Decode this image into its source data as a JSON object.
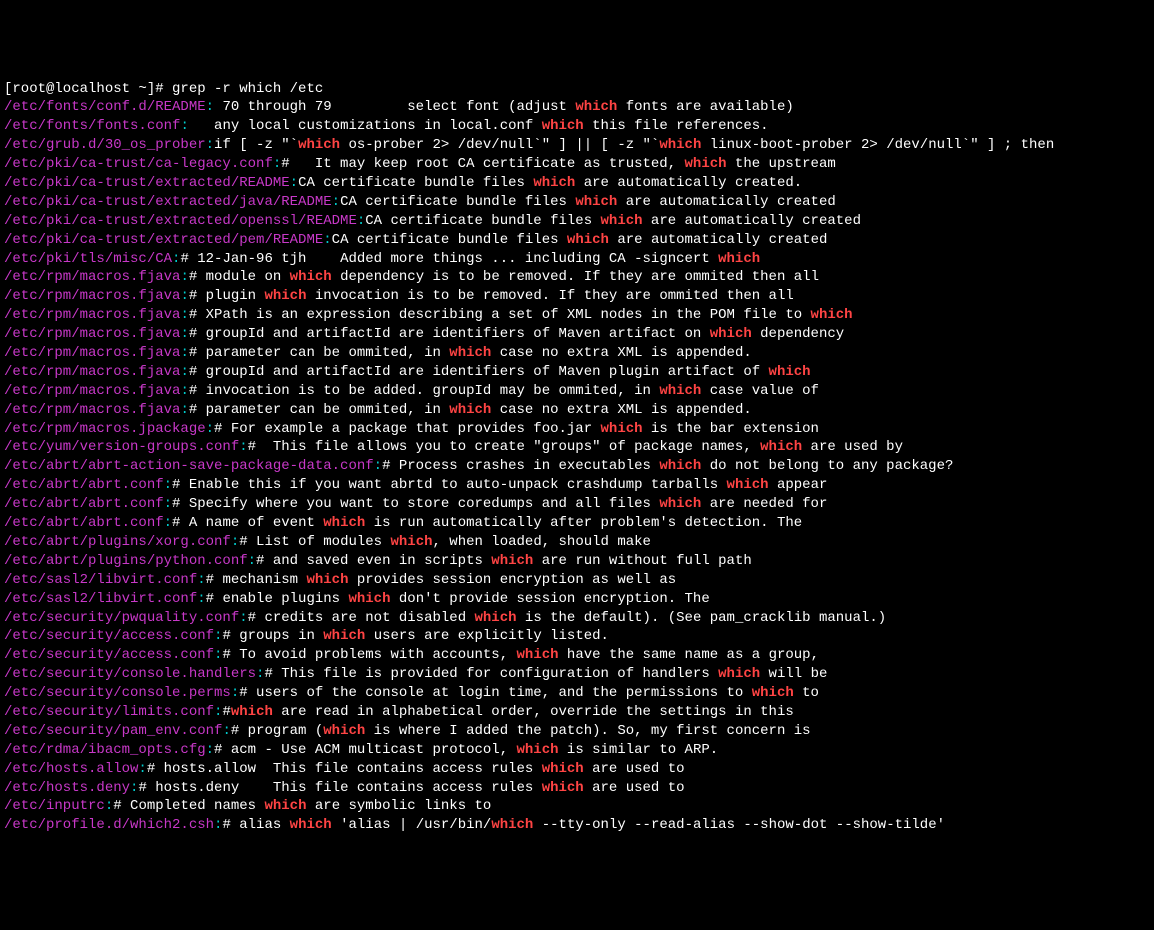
{
  "prompt": "[root@localhost ~]# grep -r which /etc",
  "lines": [
    {
      "path": "/etc/fonts/conf.d/README",
      "parts": [
        ": 70 through 79         select font (adjust ",
        "which",
        " fonts are available)"
      ]
    },
    {
      "path": "/etc/fonts/fonts.conf",
      "parts": [
        ":   any local customizations in local.conf ",
        "which",
        " this file references."
      ]
    },
    {
      "path": "/etc/grub.d/30_os_prober",
      "parts": [
        ":if [ -z \"`",
        "which",
        " os-prober 2> /dev/null`\" ] || [ -z \"`",
        "which",
        " linux-boot-prober 2> /dev/null`\" ] ; then"
      ]
    },
    {
      "path": "/etc/pki/ca-trust/ca-legacy.conf",
      "parts": [
        ":#   It may keep root CA certificate as trusted, ",
        "which",
        " the upstream"
      ]
    },
    {
      "path": "/etc/pki/ca-trust/extracted/README",
      "parts": [
        ":CA certificate bundle files ",
        "which",
        " are automatically created."
      ]
    },
    {
      "path": "/etc/pki/ca-trust/extracted/java/README",
      "parts": [
        ":CA certificate bundle files ",
        "which",
        " are automatically created"
      ]
    },
    {
      "path": "/etc/pki/ca-trust/extracted/openssl/README",
      "parts": [
        ":CA certificate bundle files ",
        "which",
        " are automatically created"
      ]
    },
    {
      "path": "/etc/pki/ca-trust/extracted/pem/README",
      "parts": [
        ":CA certificate bundle files ",
        "which",
        " are automatically created"
      ]
    },
    {
      "path": "/etc/pki/tls/misc/CA",
      "parts": [
        ":# 12-Jan-96 tjh    Added more things ... including CA -signcert ",
        "which"
      ]
    },
    {
      "path": "/etc/rpm/macros.fjava",
      "parts": [
        ":# module on ",
        "which",
        " dependency is to be removed. If they are ommited then all"
      ]
    },
    {
      "path": "/etc/rpm/macros.fjava",
      "parts": [
        ":# plugin ",
        "which",
        " invocation is to be removed. If they are ommited then all"
      ]
    },
    {
      "path": "/etc/rpm/macros.fjava",
      "parts": [
        ":# XPath is an expression describing a set of XML nodes in the POM file to ",
        "which"
      ]
    },
    {
      "path": "/etc/rpm/macros.fjava",
      "parts": [
        ":# groupId and artifactId are identifiers of Maven artifact on ",
        "which",
        " dependency"
      ]
    },
    {
      "path": "/etc/rpm/macros.fjava",
      "parts": [
        ":# parameter can be ommited, in ",
        "which",
        " case no extra XML is appended."
      ]
    },
    {
      "path": "/etc/rpm/macros.fjava",
      "parts": [
        ":# groupId and artifactId are identifiers of Maven plugin artifact of ",
        "which"
      ]
    },
    {
      "path": "/etc/rpm/macros.fjava",
      "parts": [
        ":# invocation is to be added. groupId may be ommited, in ",
        "which",
        " case value of"
      ]
    },
    {
      "path": "/etc/rpm/macros.fjava",
      "parts": [
        ":# parameter can be ommited, in ",
        "which",
        " case no extra XML is appended."
      ]
    },
    {
      "path": "/etc/rpm/macros.jpackage",
      "parts": [
        ":# For example a package that provides foo.jar ",
        "which",
        " is the bar extension"
      ]
    },
    {
      "path": "/etc/yum/version-groups.conf",
      "parts": [
        ":#  This file allows you to create \"groups\" of package names, ",
        "which",
        " are used by"
      ]
    },
    {
      "path": "/etc/abrt/abrt-action-save-package-data.conf",
      "parts": [
        ":# Process crashes in executables ",
        "which",
        " do not belong to any package?"
      ]
    },
    {
      "path": "/etc/abrt/abrt.conf",
      "parts": [
        ":# Enable this if you want abrtd to auto-unpack crashdump tarballs ",
        "which",
        " appear"
      ]
    },
    {
      "path": "/etc/abrt/abrt.conf",
      "parts": [
        ":# Specify where you want to store coredumps and all files ",
        "which",
        " are needed for"
      ]
    },
    {
      "path": "/etc/abrt/abrt.conf",
      "parts": [
        ":# A name of event ",
        "which",
        " is run automatically after problem's detection. The"
      ]
    },
    {
      "path": "/etc/abrt/plugins/xorg.conf",
      "parts": [
        ":# List of modules ",
        "which",
        ", when loaded, should make"
      ]
    },
    {
      "path": "/etc/abrt/plugins/python.conf",
      "parts": [
        ":# and saved even in scripts ",
        "which",
        " are run without full path"
      ]
    },
    {
      "path": "/etc/sasl2/libvirt.conf",
      "parts": [
        ":# mechanism ",
        "which",
        " provides session encryption as well as"
      ]
    },
    {
      "path": "/etc/sasl2/libvirt.conf",
      "parts": [
        ":# enable plugins ",
        "which",
        " don't provide session encryption. The"
      ]
    },
    {
      "path": "/etc/security/pwquality.conf",
      "parts": [
        ":# credits are not disabled ",
        "which",
        " is the default). (See pam_cracklib manual.)"
      ]
    },
    {
      "path": "/etc/security/access.conf",
      "parts": [
        ":# groups in ",
        "which",
        " users are explicitly listed."
      ]
    },
    {
      "path": "/etc/security/access.conf",
      "parts": [
        ":# To avoid problems with accounts, ",
        "which",
        " have the same name as a group,"
      ]
    },
    {
      "path": "/etc/security/console.handlers",
      "parts": [
        ":# This file is provided for configuration of handlers ",
        "which",
        " will be"
      ]
    },
    {
      "path": "/etc/security/console.perms",
      "parts": [
        ":# users of the console at login time, and the permissions to ",
        "which",
        " to"
      ]
    },
    {
      "path": "/etc/security/limits.conf",
      "parts": [
        ":#",
        "which",
        " are read in alphabetical order, override the settings in this"
      ]
    },
    {
      "path": "/etc/security/pam_env.conf",
      "parts": [
        ":# program (",
        "which",
        " is where I added the patch). So, my first concern is"
      ]
    },
    {
      "path": "/etc/rdma/ibacm_opts.cfg",
      "parts": [
        ":# acm - Use ACM multicast protocol, ",
        "which",
        " is similar to ARP."
      ]
    },
    {
      "path": "/etc/hosts.allow",
      "parts": [
        ":# hosts.allow  This file contains access rules ",
        "which",
        " are used to"
      ]
    },
    {
      "path": "/etc/hosts.deny",
      "parts": [
        ":# hosts.deny    This file contains access rules ",
        "which",
        " are used to"
      ]
    },
    {
      "path": "/etc/inputrc",
      "parts": [
        ":# Completed names ",
        "which",
        " are symbolic links to"
      ]
    },
    {
      "path": "/etc/profile.d/which2.csh",
      "parts": [
        ":# alias ",
        "which",
        " 'alias | /usr/bin/",
        "which",
        " --tty-only --read-alias --show-dot --show-tilde'"
      ]
    }
  ]
}
